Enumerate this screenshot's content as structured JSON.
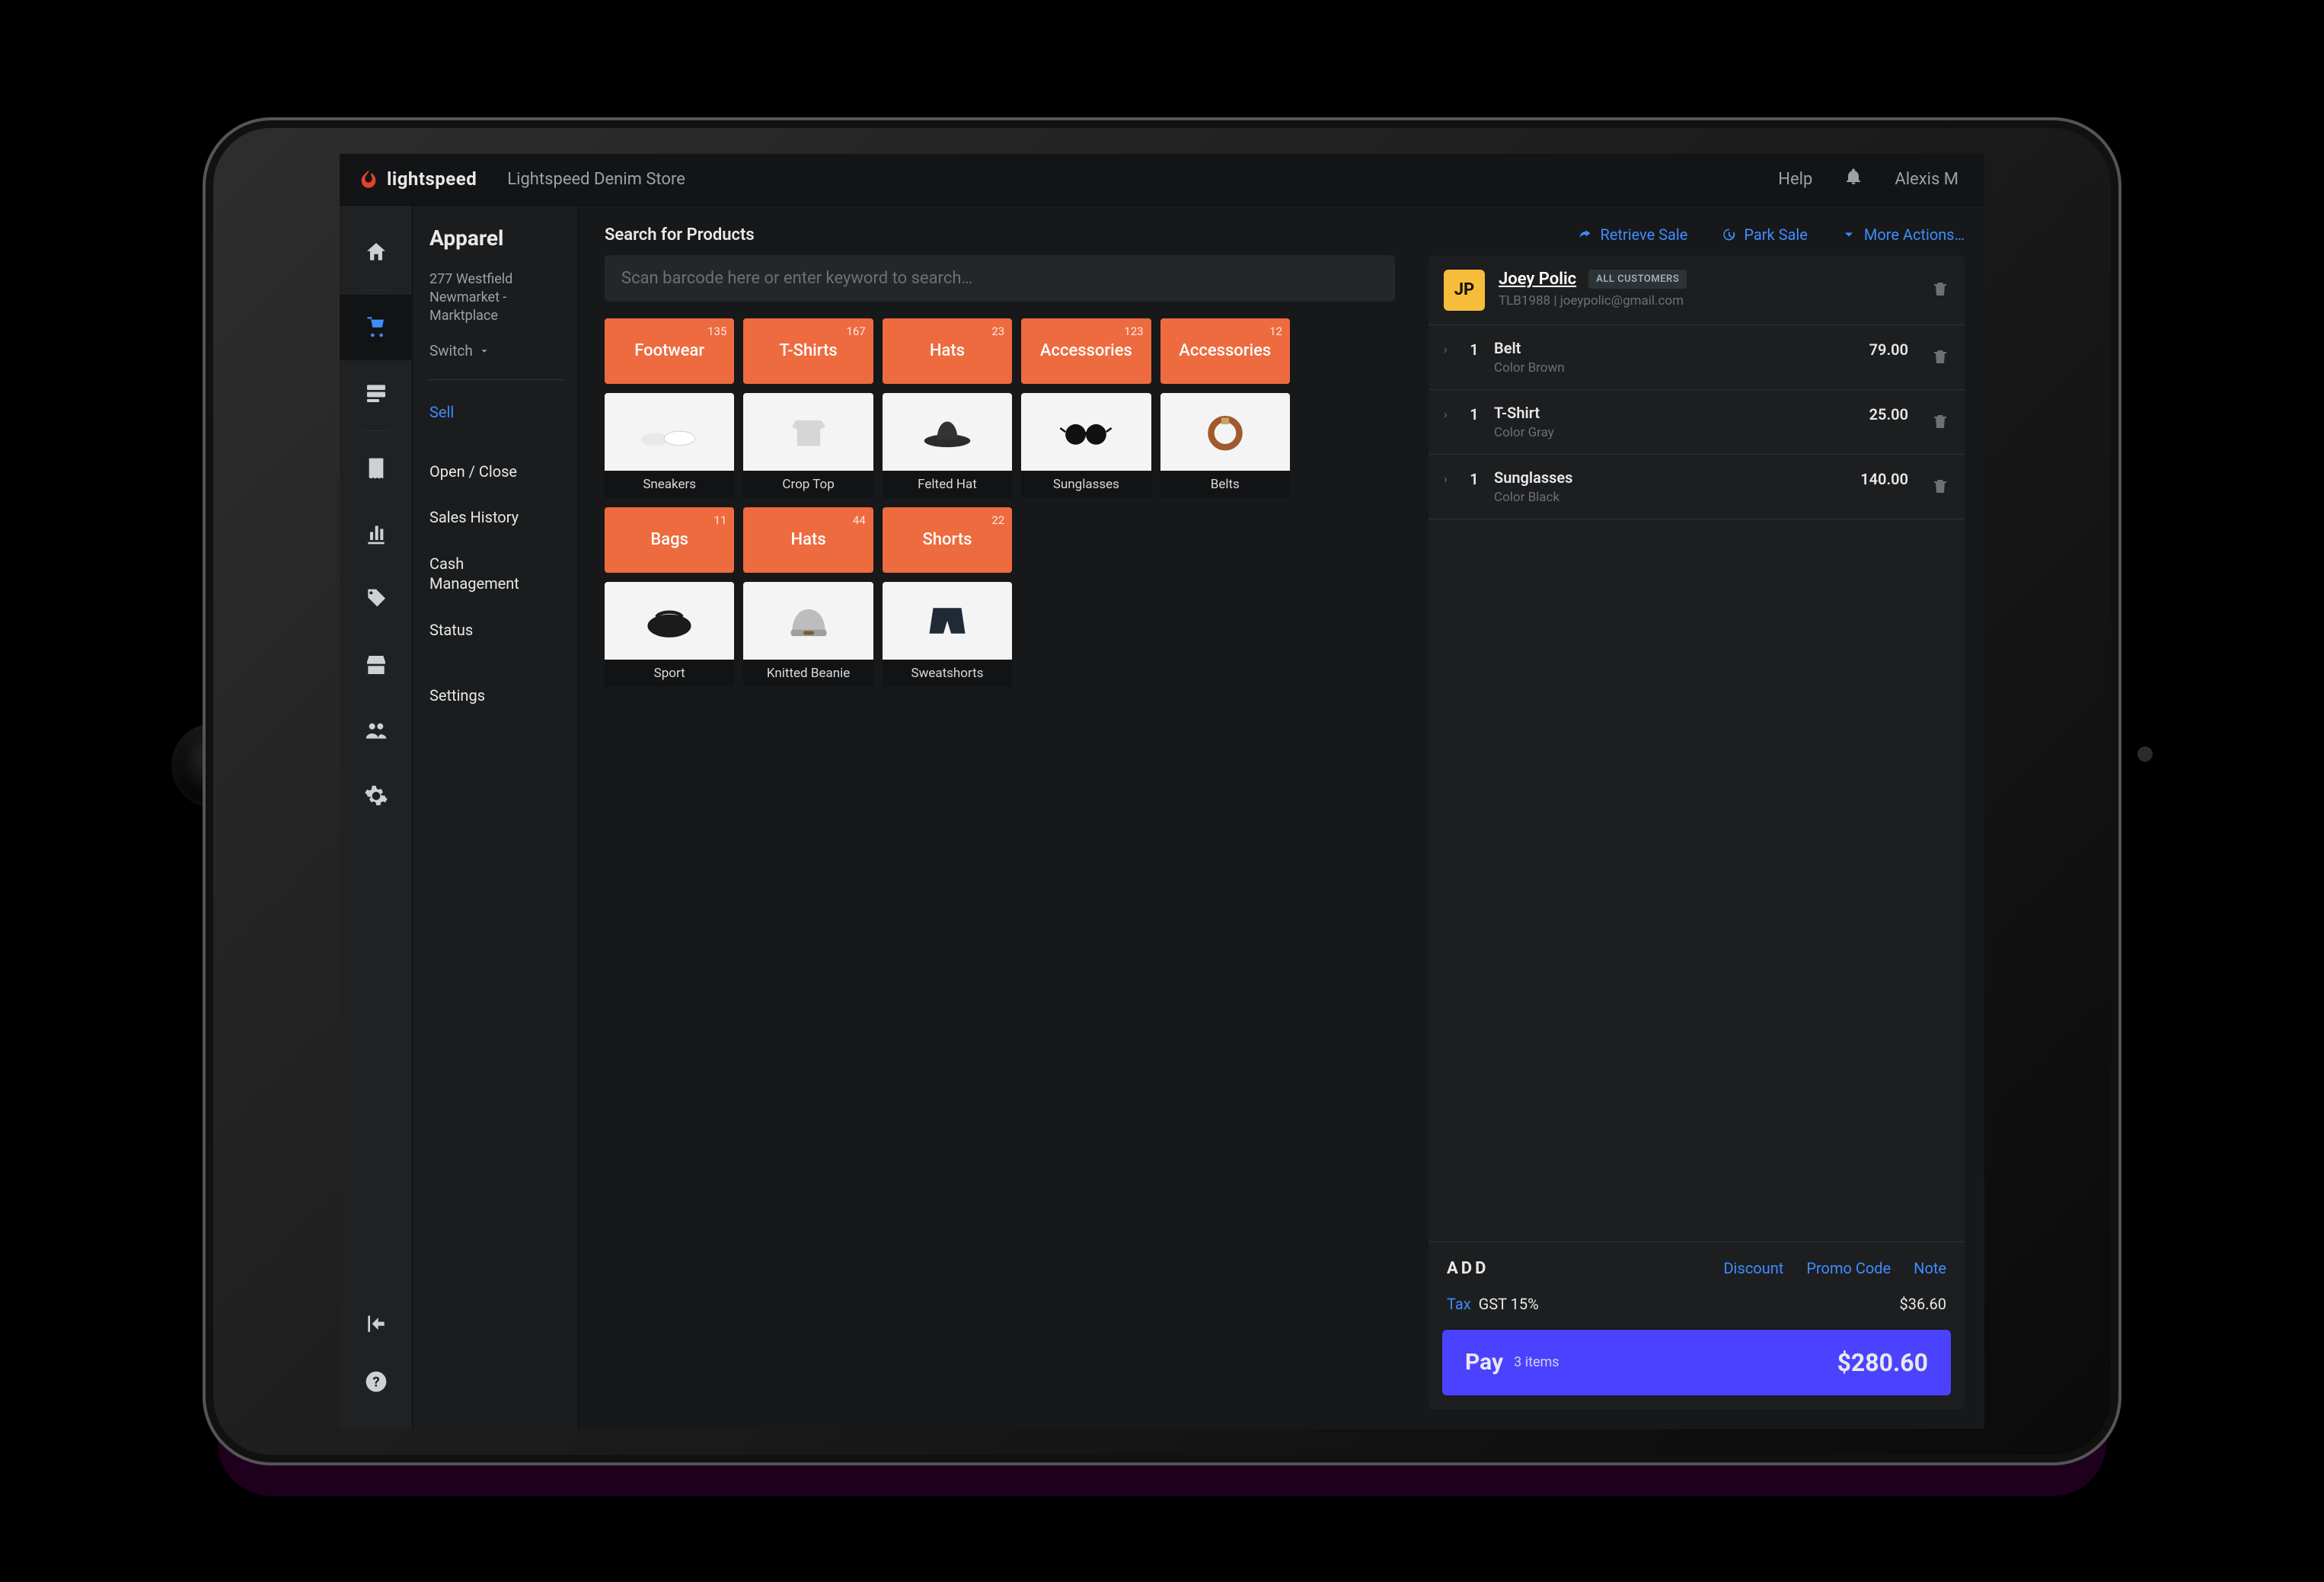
{
  "topbar": {
    "brand": "lightspeed",
    "store": "Lightspeed Denim Store",
    "help": "Help",
    "user": "Alexis  M"
  },
  "sidepanel": {
    "title": "Apparel",
    "address_l1": "277 Westfield",
    "address_l2": "Newmarket -",
    "address_l3": "Marktplace",
    "switch": "Switch",
    "links": {
      "sell": "Sell",
      "open_close": "Open / Close",
      "sales_history": "Sales History",
      "cash_mgmt_l1": "Cash",
      "cash_mgmt_l2": "Management",
      "status": "Status",
      "settings": "Settings"
    }
  },
  "products": {
    "heading": "Search for Products",
    "search_placeholder": "Scan barcode here or enter keyword to search…",
    "cats": [
      {
        "label": "Footwear",
        "count": "135"
      },
      {
        "label": "T-Shirts",
        "count": "167"
      },
      {
        "label": "Hats",
        "count": "23"
      },
      {
        "label": "Accessories",
        "count": "123"
      },
      {
        "label": "Accessories",
        "count": "12"
      }
    ],
    "row2": [
      {
        "label": "Sneakers"
      },
      {
        "label": "Crop Top"
      },
      {
        "label": "Felted Hat"
      },
      {
        "label": "Sunglasses"
      },
      {
        "label": "Belts"
      }
    ],
    "cats2": [
      {
        "label": "Bags",
        "count": "11"
      },
      {
        "label": "Hats",
        "count": "44"
      },
      {
        "label": "Shorts",
        "count": "22"
      }
    ],
    "row4": [
      {
        "label": "Sport"
      },
      {
        "label": "Knitted Beanie"
      },
      {
        "label": "Sweatshorts"
      }
    ]
  },
  "cart": {
    "actions": {
      "retrieve": "Retrieve Sale",
      "park": "Park Sale",
      "more": "More Actions…"
    },
    "customer": {
      "initials": "JP",
      "name": "Joey Polic",
      "badge": "ALL CUSTOMERS",
      "meta": "TLB1988  |  joeypolic@gmail.com"
    },
    "lines": [
      {
        "qty": "1",
        "name": "Belt",
        "variant": "Color Brown",
        "price": "79.00"
      },
      {
        "qty": "1",
        "name": "T-Shirt",
        "variant": "Color Gray",
        "price": "25.00"
      },
      {
        "qty": "1",
        "name": "Sunglasses",
        "variant": "Color Black",
        "price": "140.00"
      }
    ],
    "footer": {
      "add": "ADD",
      "discount": "Discount",
      "promo": "Promo Code",
      "note": "Note",
      "tax_label": "Tax",
      "tax_name": "GST 15%",
      "tax_amount": "$36.60",
      "pay_label": "Pay",
      "pay_items": "3 items",
      "pay_amount": "$280.60"
    }
  }
}
